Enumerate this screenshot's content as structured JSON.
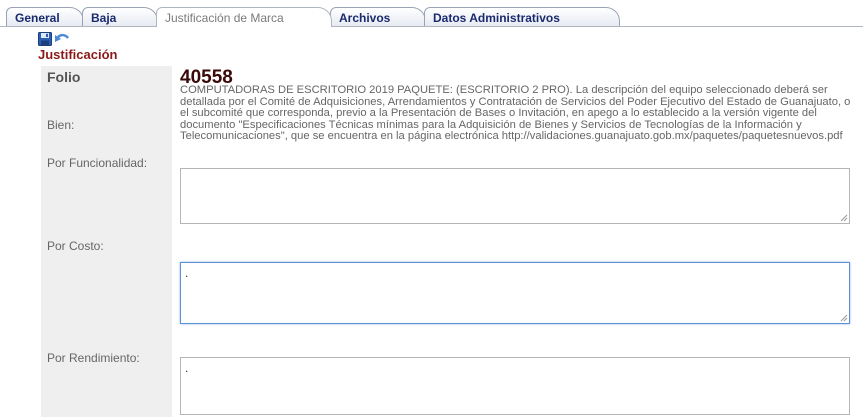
{
  "tabs": [
    {
      "label": "General",
      "active": false
    },
    {
      "label": "Baja",
      "active": false
    },
    {
      "label": "Justificación de Marca",
      "active": true
    },
    {
      "label": "Archivos",
      "active": false
    },
    {
      "label": "Datos Administrativos",
      "active": false
    }
  ],
  "toolbar": {
    "save_icon": "save-icon",
    "undo_icon": "undo-icon"
  },
  "section_title": "Justificación",
  "folio": {
    "label": "Folio",
    "value": "40558"
  },
  "bien": {
    "label": "Bien:",
    "text": "COMPUTADORAS DE ESCRITORIO 2019 PAQUETE: (ESCRITORIO 2 PRO). La descripción del equipo seleccionado deberá ser detallada por el Comité de Adquisiciones, Arrendamientos y Contratación de Servicios del Poder Ejecutivo del Estado de Guanajuato, o el subcomité que corresponda, previo a la Presentación de Bases o Invitación, en apego a lo establecido a la versión vigente del documento \"Especificaciones Técnicas mínimas para la Adquisición de Bienes y Servicios de Tecnologías de la Información y Telecomunicaciones\", que se encuentra en la página electrónica http://validaciones.guanajuato.gob.mx/paquetes/paquetesnuevos.pdf"
  },
  "funcionalidad": {
    "label": "Por Funcionalidad:",
    "value": ""
  },
  "costo": {
    "label": "Por Costo:",
    "value": "."
  },
  "rendimiento": {
    "label": "Por Rendimiento:",
    "value": "."
  },
  "colors": {
    "tab_text": "#1a2a6e",
    "title": "#8b1a1a",
    "folio_value": "#3a0a0a",
    "focus_border": "#5b8fd6"
  }
}
